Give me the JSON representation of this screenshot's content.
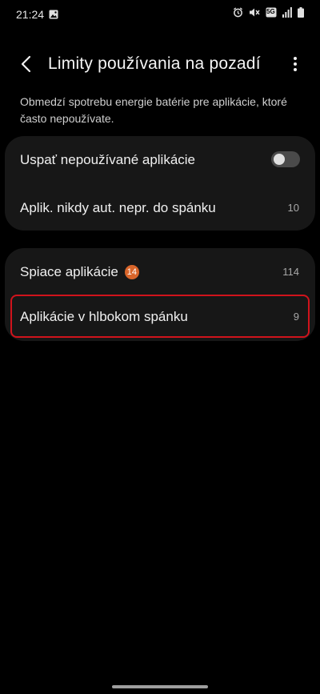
{
  "status_bar": {
    "time": "21:24",
    "network_badge": "5G",
    "icons": [
      "gallery-icon",
      "alarm-icon",
      "mute-icon",
      "signal-icon",
      "battery-icon"
    ]
  },
  "header": {
    "title": "Limity používania na pozadí"
  },
  "description": "Obmedzí spotrebu energie batérie pre aplikácie, ktoré často nepoužívate.",
  "group1": {
    "sleep_unused": {
      "label": "Uspať nepoužívané aplikácie",
      "enabled": false
    },
    "never_sleeping": {
      "label": "Aplik. nikdy aut. nepr. do spánku",
      "count": "10"
    }
  },
  "group2": {
    "sleeping": {
      "label": "Spiace aplikácie",
      "badge": "14",
      "count": "114"
    },
    "deep_sleeping": {
      "label": "Aplikácie v hlbokom spánku",
      "count": "9"
    }
  },
  "colors": {
    "background": "#000000",
    "card": "#171717",
    "badge": "#d9652a",
    "highlight_border": "#d0131c"
  }
}
